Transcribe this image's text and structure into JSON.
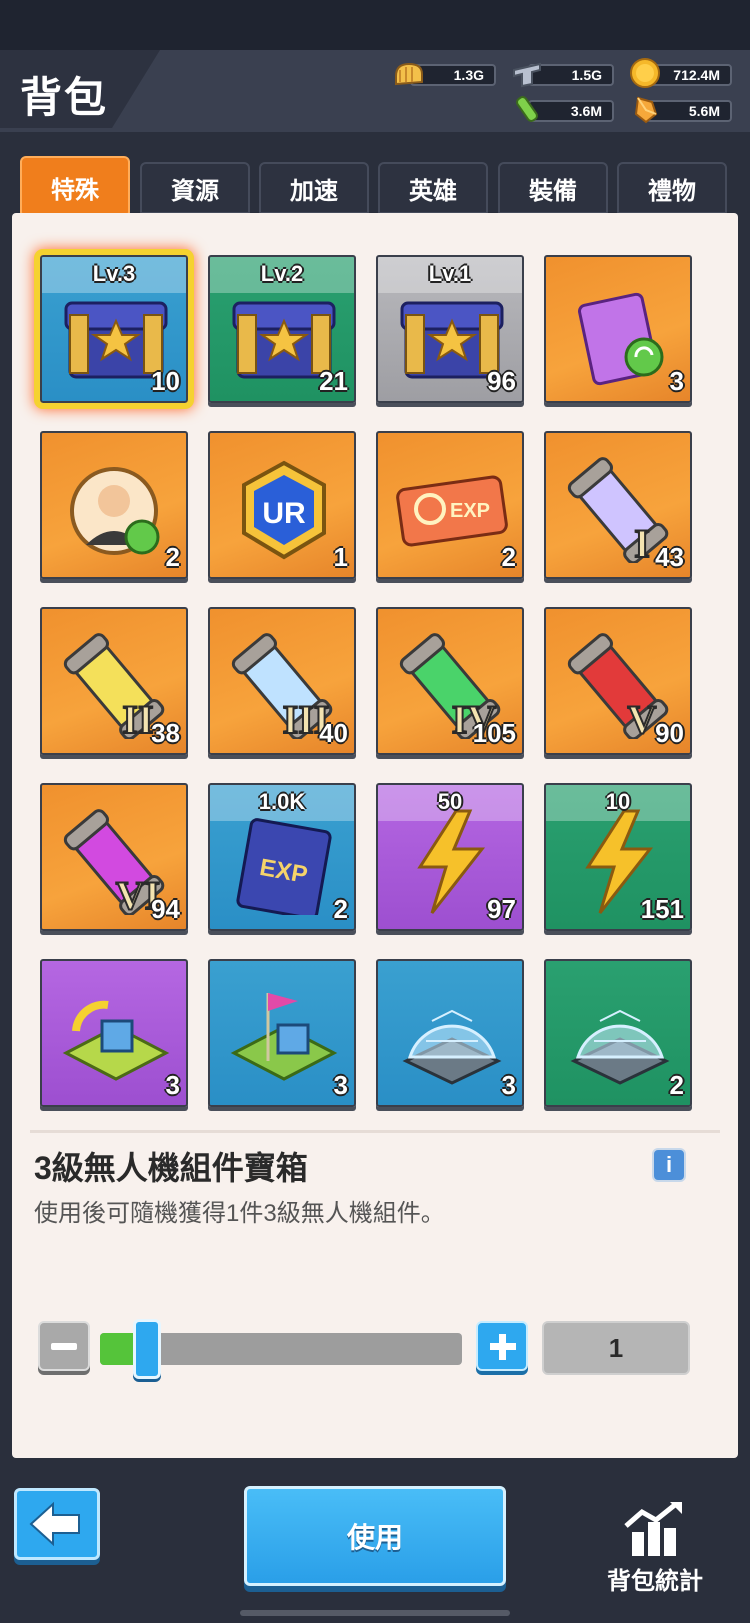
{
  "header": {
    "title": "背包"
  },
  "resources": [
    {
      "icon": "bread-icon",
      "value": "1.3G"
    },
    {
      "icon": "iron-ingot-icon",
      "value": "1.5G"
    },
    {
      "icon": "gold-coin-icon",
      "value": "712.4M"
    },
    {
      "icon": "green-vial-icon",
      "value": "3.6M"
    },
    {
      "icon": "crystal-shard-icon",
      "value": "5.6M"
    }
  ],
  "tabs": [
    "特殊",
    "資源",
    "加速",
    "英雄",
    "裝備",
    "禮物"
  ],
  "active_tab": "特殊",
  "items": [
    {
      "icon": "drone-chest-icon",
      "level": "Lv.3",
      "qty": "10",
      "bg": "blue"
    },
    {
      "icon": "drone-chest-icon",
      "level": "Lv.2",
      "qty": "21",
      "bg": "green"
    },
    {
      "icon": "drone-chest-icon",
      "level": "Lv.1",
      "qty": "96",
      "bg": "gray"
    },
    {
      "icon": "skill-book-reset-icon",
      "level": "",
      "qty": "3",
      "bg": "orange"
    },
    {
      "icon": "hero-reset-icon",
      "level": "",
      "qty": "2",
      "bg": "orange"
    },
    {
      "icon": "ur-badge-icon",
      "level": "",
      "qty": "1",
      "bg": "orange"
    },
    {
      "icon": "exp-reset-ticket-icon",
      "level": "",
      "qty": "2",
      "bg": "orange"
    },
    {
      "icon": "capsule-i-icon",
      "level": "",
      "qty": "43",
      "bg": "orange"
    },
    {
      "icon": "capsule-ii-icon",
      "level": "",
      "qty": "38",
      "bg": "orange"
    },
    {
      "icon": "capsule-iii-icon",
      "level": "",
      "qty": "40",
      "bg": "orange"
    },
    {
      "icon": "capsule-iv-icon",
      "level": "",
      "qty": "105",
      "bg": "orange"
    },
    {
      "icon": "capsule-v-icon",
      "level": "",
      "qty": "90",
      "bg": "orange"
    },
    {
      "icon": "capsule-vi-icon",
      "level": "",
      "qty": "94",
      "bg": "orange"
    },
    {
      "icon": "exp-book-icon",
      "level": "1.0K",
      "qty": "2",
      "bg": "blue"
    },
    {
      "icon": "lightning-icon",
      "level": "50",
      "qty": "97",
      "bg": "purple"
    },
    {
      "icon": "lightning-icon",
      "level": "10",
      "qty": "151",
      "bg": "green"
    },
    {
      "icon": "base-relocate-icon",
      "level": "",
      "qty": "3",
      "bg": "purple"
    },
    {
      "icon": "base-flag-icon",
      "level": "",
      "qty": "3",
      "bg": "blue"
    },
    {
      "icon": "shield-dome-icon",
      "level": "",
      "qty": "3",
      "bg": "blue"
    },
    {
      "icon": "shield-dome-icon",
      "level": "",
      "qty": "2",
      "bg": "green"
    }
  ],
  "detail": {
    "name": "3級無人機組件寶箱",
    "description": "使用後可隨機獲得1件3級無人機組件。"
  },
  "quantity": {
    "value": "1",
    "slider_fraction": 0.13
  },
  "buttons": {
    "use": "使用",
    "stats": "背包統計"
  }
}
